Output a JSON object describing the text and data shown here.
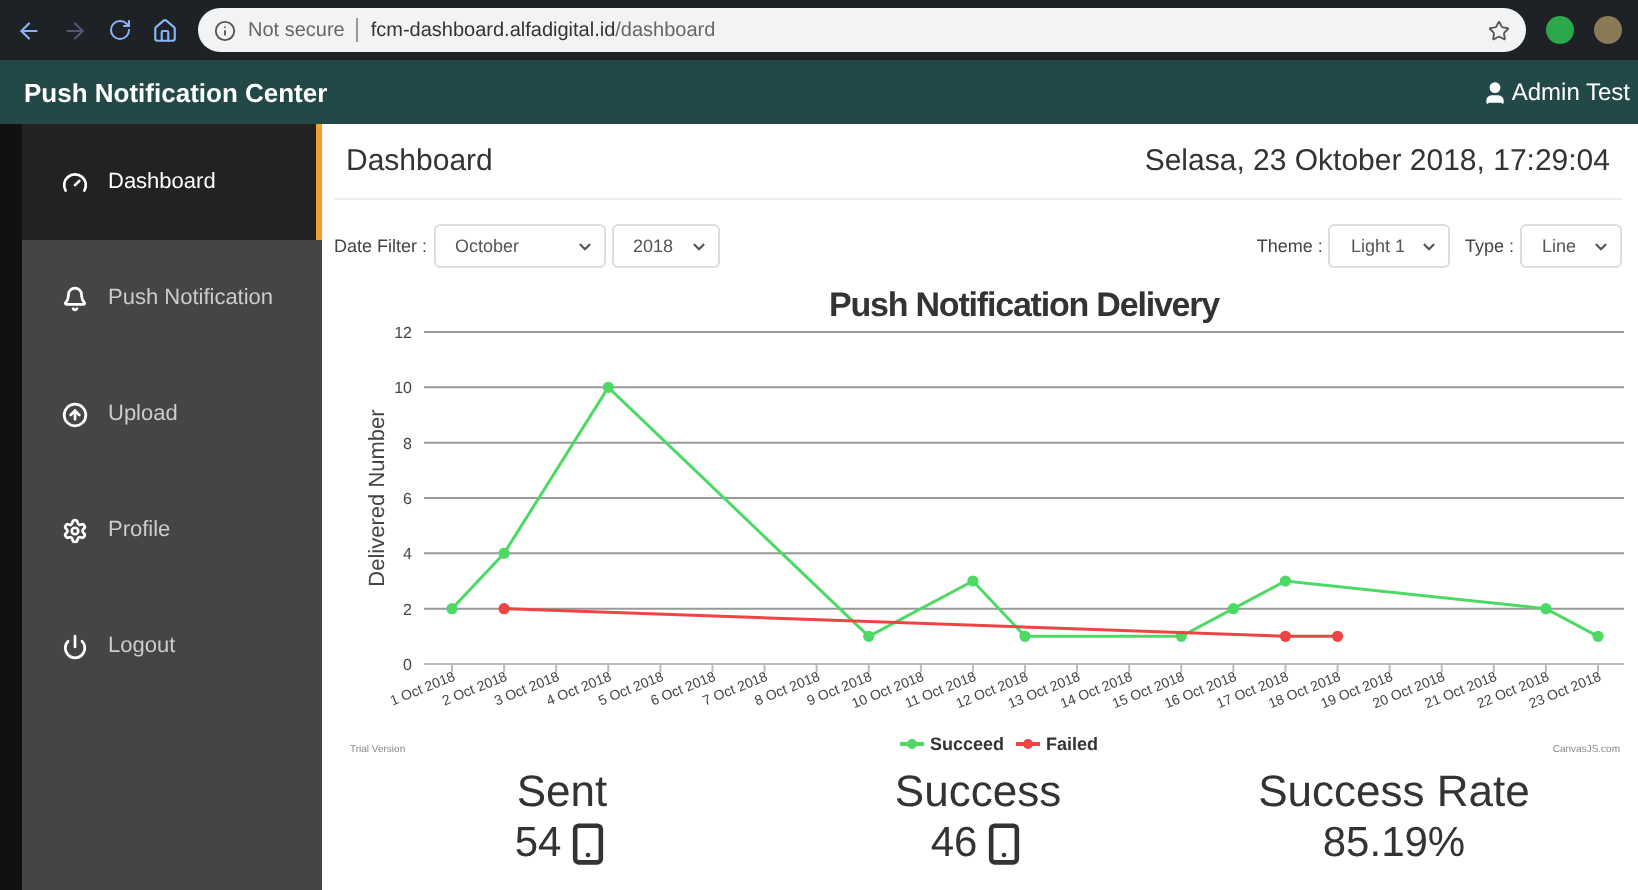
{
  "browser": {
    "security": "Not secure",
    "url_host": "fcm-dashboard.alfadigital.id",
    "url_path": "/dashboard"
  },
  "header": {
    "title": "Push Notification Center",
    "user": "Admin Test"
  },
  "sidebar": {
    "items": [
      {
        "label": "Dashboard",
        "selected": true
      },
      {
        "label": "Push Notification",
        "selected": false
      },
      {
        "label": "Upload",
        "selected": false
      },
      {
        "label": "Profile",
        "selected": false
      },
      {
        "label": "Logout",
        "selected": false
      }
    ]
  },
  "page": {
    "title": "Dashboard",
    "datetime": "Selasa, 23 Oktober 2018, 17:29:04"
  },
  "filters": {
    "left": [
      {
        "label": "Date Filter :",
        "selects": [
          "October",
          "2018"
        ]
      }
    ],
    "right": [
      {
        "label": "Theme :",
        "selects": [
          "Light 1"
        ]
      },
      {
        "label": "Type :",
        "selects": [
          "Line"
        ]
      }
    ]
  },
  "chart": {
    "trial": "Trial Version",
    "credit": "CanvasJS.com",
    "chart_data": {
      "type": "line",
      "title": "Push Notification Delivery",
      "ylabel": "Delivered Number",
      "categories": [
        "1 Oct 2018",
        "2 Oct 2018",
        "3 Oct 2018",
        "4 Oct 2018",
        "5 Oct 2018",
        "6 Oct 2018",
        "7 Oct 2018",
        "8 Oct 2018",
        "9 Oct 2018",
        "10 Oct 2018",
        "11 Oct 2018",
        "12 Oct 2018",
        "13 Oct 2018",
        "14 Oct 2018",
        "15 Oct 2018",
        "16 Oct 2018",
        "17 Oct 2018",
        "18 Oct 2018",
        "19 Oct 2018",
        "20 Oct 2018",
        "21 Oct 2018",
        "22 Oct 2018",
        "23 Oct 2018"
      ],
      "ylim": [
        0,
        12
      ],
      "yticks": [
        0,
        2,
        4,
        6,
        8,
        10,
        12
      ],
      "grid": true,
      "legend": true,
      "series": [
        {
          "name": "Succeed",
          "color": "#4cd964",
          "marker": "circle",
          "values": [
            2,
            4,
            null,
            10,
            null,
            null,
            null,
            null,
            1,
            null,
            3,
            1,
            null,
            null,
            1,
            2,
            3,
            null,
            null,
            null,
            null,
            2,
            1
          ]
        },
        {
          "name": "Failed",
          "color": "#ee4444",
          "marker": "circle",
          "values": [
            null,
            2,
            null,
            null,
            null,
            null,
            null,
            null,
            null,
            null,
            null,
            null,
            null,
            null,
            null,
            null,
            1,
            1,
            null,
            null,
            null,
            null,
            null
          ]
        }
      ]
    }
  },
  "stats": [
    {
      "label": "Sent",
      "value": "54",
      "kind": "count"
    },
    {
      "label": "Success",
      "value": "46",
      "kind": "count"
    },
    {
      "label": "Success Rate",
      "value": "85.19%",
      "kind": "rate"
    }
  ]
}
